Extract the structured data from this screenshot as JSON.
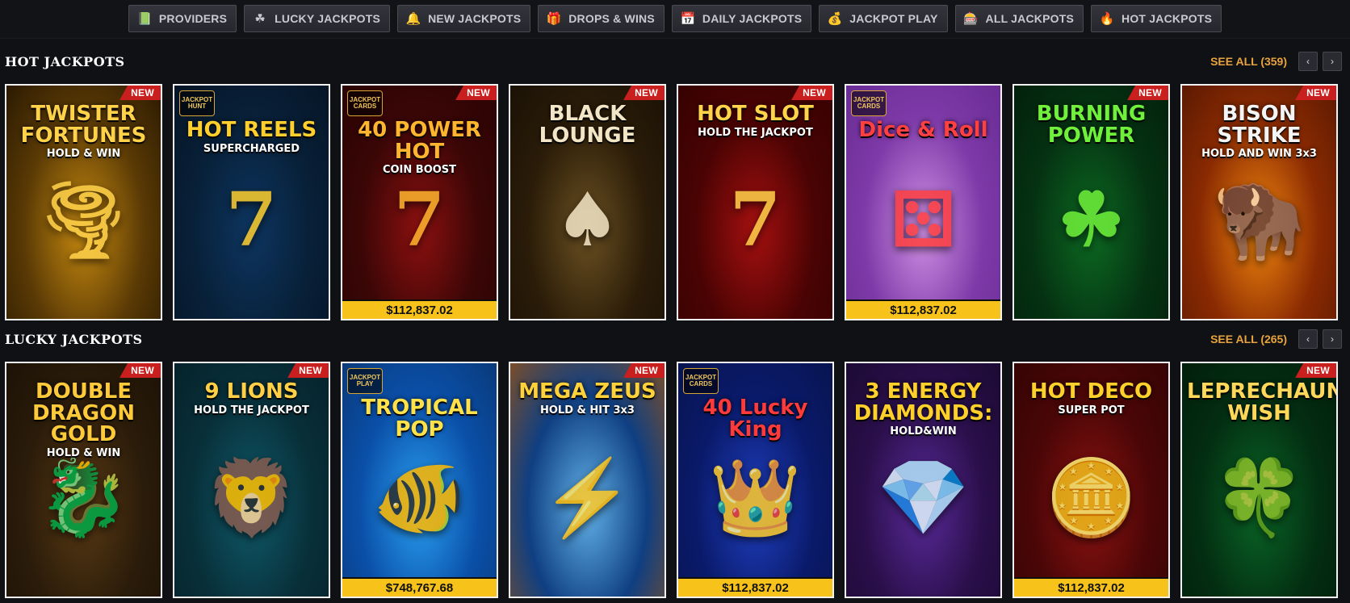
{
  "nav": [
    {
      "label": "PROVIDERS",
      "icon": "book-icon",
      "glyph": "📗"
    },
    {
      "label": "LUCKY JACKPOTS",
      "icon": "clover-icon",
      "glyph": "☘"
    },
    {
      "label": "NEW JACKPOTS",
      "icon": "bell-icon",
      "glyph": "🔔"
    },
    {
      "label": "DROPS & WINS",
      "icon": "drops-icon",
      "glyph": "🎁"
    },
    {
      "label": "DAILY JACKPOTS",
      "icon": "calendar-icon",
      "glyph": "📅"
    },
    {
      "label": "JACKPOT PLAY",
      "icon": "money-bag-icon",
      "glyph": "💰"
    },
    {
      "label": "ALL JACKPOTS",
      "icon": "slot-machine-icon",
      "glyph": "🎰"
    },
    {
      "label": "HOT JACKPOTS",
      "icon": "fire-icon",
      "glyph": "🔥"
    }
  ],
  "sections": [
    {
      "title": "HOT JACKPOTS",
      "see_all": "SEE ALL (359)",
      "games": [
        {
          "name": "TWISTER FORTUNES",
          "sub": "HOLD & WIN",
          "new": true,
          "bg": [
            "#5a3a05",
            "#c78a10",
            "#2b1a02"
          ],
          "color": "#ffd24a"
        },
        {
          "name": "HOT REELS",
          "sub": "SUPERCHARGED",
          "new": false,
          "badge": "JACKPOT HUNT",
          "bg": [
            "#082038",
            "#0d3560",
            "#061526"
          ],
          "color": "#ffcf2e"
        },
        {
          "name": "40 POWER HOT",
          "sub": "COIN BOOST",
          "new": true,
          "badge": "JACKPOT CARDS",
          "bg": [
            "#3a0606",
            "#8c1010",
            "#2a0303"
          ],
          "color": "#ffb52e",
          "jackpot": "$112,837.02"
        },
        {
          "name": "BLACK LOUNGE",
          "sub": "",
          "new": true,
          "bg": [
            "#2a1c08",
            "#6b5022",
            "#1a1106"
          ],
          "color": "#f3e6c6"
        },
        {
          "name": "HOT SLOT",
          "sub": "HOLD THE JACKPOT",
          "new": true,
          "bg": [
            "#4a0303",
            "#a51010",
            "#360202"
          ],
          "color": "#ffd34a"
        },
        {
          "name": "Dice & Roll",
          "sub": "",
          "new": false,
          "badge": "JACKPOT CARDS",
          "bg": [
            "#7d3aa8",
            "#d08fe3",
            "#6a2c95"
          ],
          "color": "#ff4040",
          "jackpot": "$112,837.02"
        },
        {
          "name": "BURNING POWER",
          "sub": "",
          "new": true,
          "bg": [
            "#053212",
            "#0c6a22",
            "#02200b"
          ],
          "color": "#6ff03a"
        },
        {
          "name": "BISON STRIKE",
          "sub": "HOLD AND WIN 3x3",
          "new": true,
          "bg": [
            "#8a2a02",
            "#f0860e",
            "#5c1a02"
          ],
          "color": "#f4f4f4"
        }
      ]
    },
    {
      "title": "LUCKY JACKPOTS",
      "see_all": "SEE ALL (265)",
      "games": [
        {
          "name": "DOUBLE DRAGON GOLD",
          "sub": "HOLD & WIN",
          "new": true,
          "bg": [
            "#2b1c0a",
            "#5a3a14",
            "#1c1206"
          ],
          "color": "#ffca3a"
        },
        {
          "name": "9 LIONS",
          "sub": "HOLD THE JACKPOT",
          "new": true,
          "bg": [
            "#08303a",
            "#0f5a6a",
            "#06222a"
          ],
          "color": "#ffd045"
        },
        {
          "name": "TROPICAL POP",
          "sub": "",
          "new": false,
          "badge": "JACKPOT PLAY",
          "bg": [
            "#0a4fa8",
            "#2aa0f0",
            "#0a3a7a"
          ],
          "color": "#ffe14a",
          "jackpot": "$748,767.68"
        },
        {
          "name": "MEGA ZEUS",
          "sub": "HOLD & HIT 3x3",
          "new": true,
          "bg": [
            "#0f3f82",
            "#62b2e8",
            "#7a4e2a"
          ],
          "color": "#ffd23a"
        },
        {
          "name": "40 Lucky King",
          "sub": "",
          "new": false,
          "badge": "JACKPOT CARDS",
          "bg": [
            "#0a1a6a",
            "#1f3fc0",
            "#081450"
          ],
          "color": "#ff3a3a",
          "jackpot": "$112,837.02"
        },
        {
          "name": "3 ENERGY DIAMONDS:",
          "sub": "HOLD&WIN",
          "new": false,
          "bg": [
            "#2a0f4a",
            "#5a2a9a",
            "#1c0a34"
          ],
          "color": "#ffd02a"
        },
        {
          "name": "HOT DECO",
          "sub": "SUPER POT",
          "new": false,
          "bg": [
            "#4a0606",
            "#8c1212",
            "#360404"
          ],
          "color": "#ffcf2a",
          "jackpot": "$112,837.02"
        },
        {
          "name": "LEPRECHAUN WISH",
          "sub": "",
          "new": true,
          "bg": [
            "#032e12",
            "#0a6626",
            "#021e0b"
          ],
          "color": "#ffd85a"
        }
      ]
    }
  ],
  "labels": {
    "new": "NEW",
    "prev": "‹",
    "next": "›"
  }
}
